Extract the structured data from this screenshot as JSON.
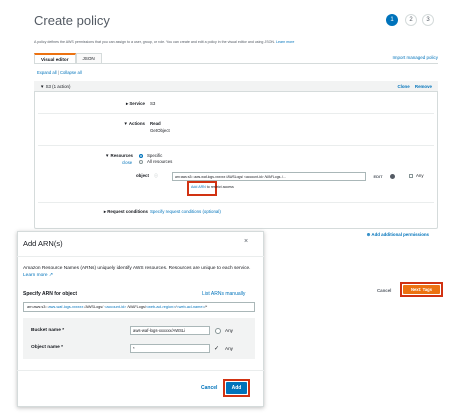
{
  "page": {
    "title": "Create policy",
    "steps": [
      "1",
      "2",
      "3"
    ],
    "description": "A policy defines the AWS permissions that you can assign to a user, group, or role. You can create and edit a policy in the visual editor and using JSON.",
    "learn_more": "Learn more",
    "import_link": "Import managed policy",
    "tabs": [
      "Visual editor",
      "JSON"
    ],
    "expand_all": "Expand all",
    "collapse_all": "Collapse all",
    "separator": " | "
  },
  "permission_block": {
    "header": "▼ S3 (1 action)",
    "clone": "Clone",
    "remove": "Remove",
    "service_label": "▸ Service",
    "service_value": "S3",
    "actions_label": "▼ Actions",
    "actions_access": "Read",
    "actions_value": "GetObject",
    "resources_label": "▼ Resources",
    "resources_close": "close",
    "resources_specific": "Specific",
    "resources_all": "All resources",
    "object_label": "object",
    "arn_value": "arn:aws:s3:::aws-waf-logs-xxxxxx /AWSLogs/ <account-id> /WAFLogs../...",
    "edit": "EDIT",
    "any": "Any",
    "add_arn": "Add ARN",
    "restrict_access": " to restrict access",
    "request_conditions_label": "▸ Request conditions",
    "request_conditions_value": "Specify request conditions (optional)",
    "add_additional": "Add additional permissions"
  },
  "footer": {
    "cancel": "Cancel",
    "next": "Next: Tags"
  },
  "modal": {
    "title": "Add ARN(s)",
    "close": "×",
    "description": "Amazon Resource Names (ARNs) uniquely identify AWS resources. Resources are unique to each service.",
    "learn_more": "Learn more ↗",
    "specify_label": "Specify ARN for object",
    "list_arns": "List ARNs manually",
    "arn_prefix": "arn:aws:s3:::",
    "arn_bucket": "aws-waf-logs-xxxxxx",
    "arn_mid": " /AWSLogs/ ",
    "arn_account": "<account-id>",
    "arn_waf": " /WAFLogs/",
    "arn_region": "<web-acl-region>",
    "arn_slash": "/",
    "arn_acl": "<web-acl-name>",
    "arn_suffix": "/*",
    "bucket_label": "Bucket name *",
    "bucket_value": "aws-waf-logs-xxxxxx/AWSLi",
    "bucket_any": "Any",
    "object_label": "Object name *",
    "object_value": "*",
    "object_any": "Any",
    "cancel": "Cancel",
    "add": "Add"
  },
  "colors": {
    "accent_blue": "#0073bb",
    "primary_orange": "#ec7211",
    "highlight_red": "#d13212"
  }
}
